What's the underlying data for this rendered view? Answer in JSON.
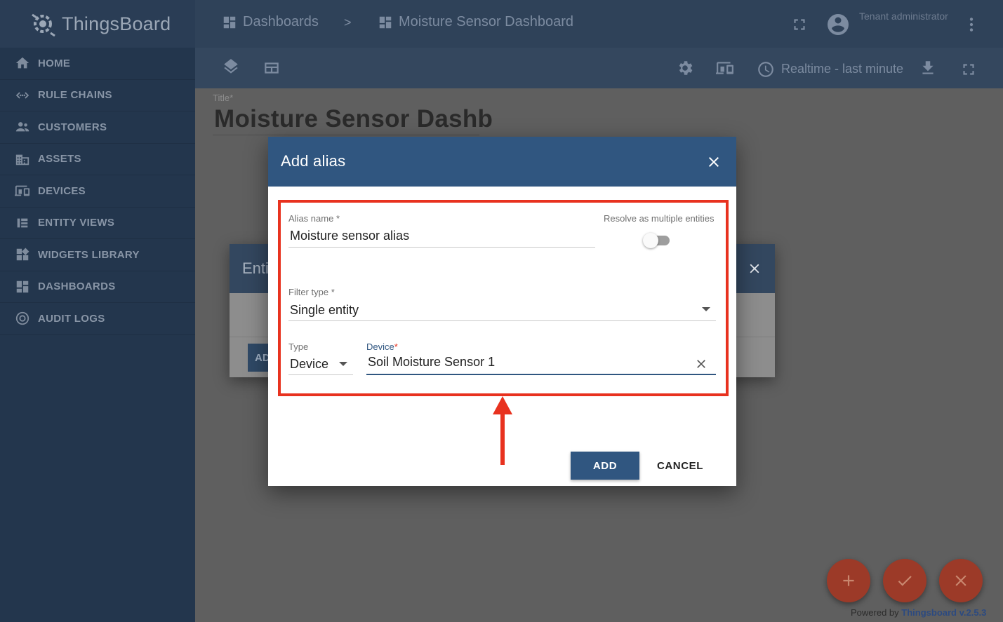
{
  "app": {
    "brand": "ThingsBoard"
  },
  "sidebar": {
    "items": [
      {
        "label": "HOME",
        "icon": "home-icon"
      },
      {
        "label": "RULE CHAINS",
        "icon": "rule-chains-icon"
      },
      {
        "label": "CUSTOMERS",
        "icon": "customers-icon"
      },
      {
        "label": "ASSETS",
        "icon": "assets-icon"
      },
      {
        "label": "DEVICES",
        "icon": "devices-icon"
      },
      {
        "label": "ENTITY VIEWS",
        "icon": "entity-views-icon"
      },
      {
        "label": "WIDGETS LIBRARY",
        "icon": "widgets-library-icon"
      },
      {
        "label": "DASHBOARDS",
        "icon": "dashboards-icon"
      },
      {
        "label": "AUDIT LOGS",
        "icon": "audit-logs-icon"
      }
    ]
  },
  "header": {
    "breadcrumb_root": "Dashboards",
    "breadcrumb_sep": ">",
    "breadcrumb_current": "Moisture Sensor Dashboard",
    "user_role": "Tenant administrator"
  },
  "toolbar": {
    "timewindow": "Realtime - last minute"
  },
  "main": {
    "title_label": "Title",
    "title_required": "*",
    "title_value": "Moisture Sensor Dashb"
  },
  "back_dialog": {
    "title": "Enti",
    "add_label": "AD"
  },
  "dialog": {
    "title": "Add alias",
    "alias_name_label": "Alias name",
    "alias_name_value": "Moisture sensor alias",
    "resolve_multiple_label": "Resolve as multiple entities",
    "resolve_multiple_on": false,
    "filter_type_label": "Filter type",
    "filter_type_value": "Single entity",
    "type_label": "Type",
    "type_value": "Device",
    "device_label": "Device",
    "device_value": "Soil Moisture Sensor 1",
    "required_mark": "*",
    "add_label": "ADD",
    "cancel_label": "CANCEL"
  },
  "colors": {
    "header": "#305680",
    "highlight": "#e8321f",
    "fab": "#9c3a28"
  },
  "footer": {
    "powered_prefix": "Powered by",
    "powered_link": "Thingsboard v.2.5.3"
  }
}
